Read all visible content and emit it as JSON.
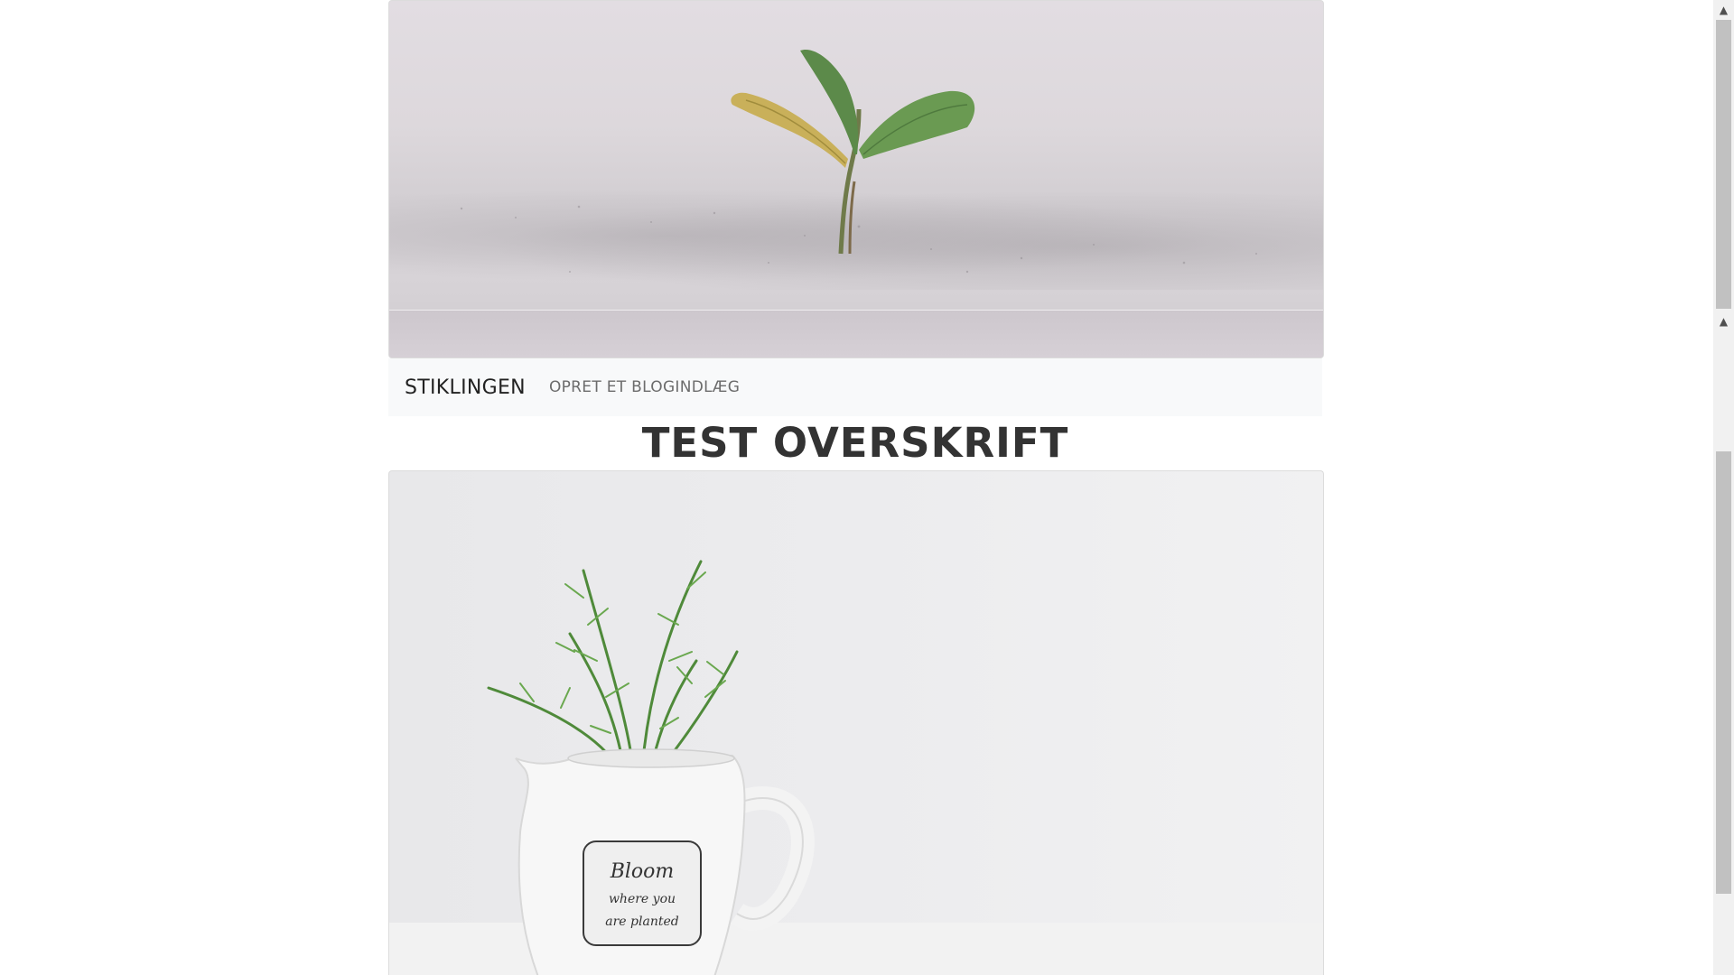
{
  "navbar": {
    "brand": "STIKLINGEN",
    "links": [
      "OPRET ET BLOGINDLÆG"
    ]
  },
  "post": {
    "title": "TEST OVERSKRIFT",
    "pitcher_label": [
      "Bloom",
      "where you",
      "are planted"
    ]
  },
  "scrollbar": {
    "up_glyph": "▲",
    "down_glyph": "▲"
  },
  "colors": {
    "navbar_bg": "#f8f9fa",
    "title": "#333333",
    "scroll_thumb": "#c1c1c1"
  },
  "icons": [
    "scroll-up-arrow-icon",
    "scroll-down-arrow-icon"
  ]
}
